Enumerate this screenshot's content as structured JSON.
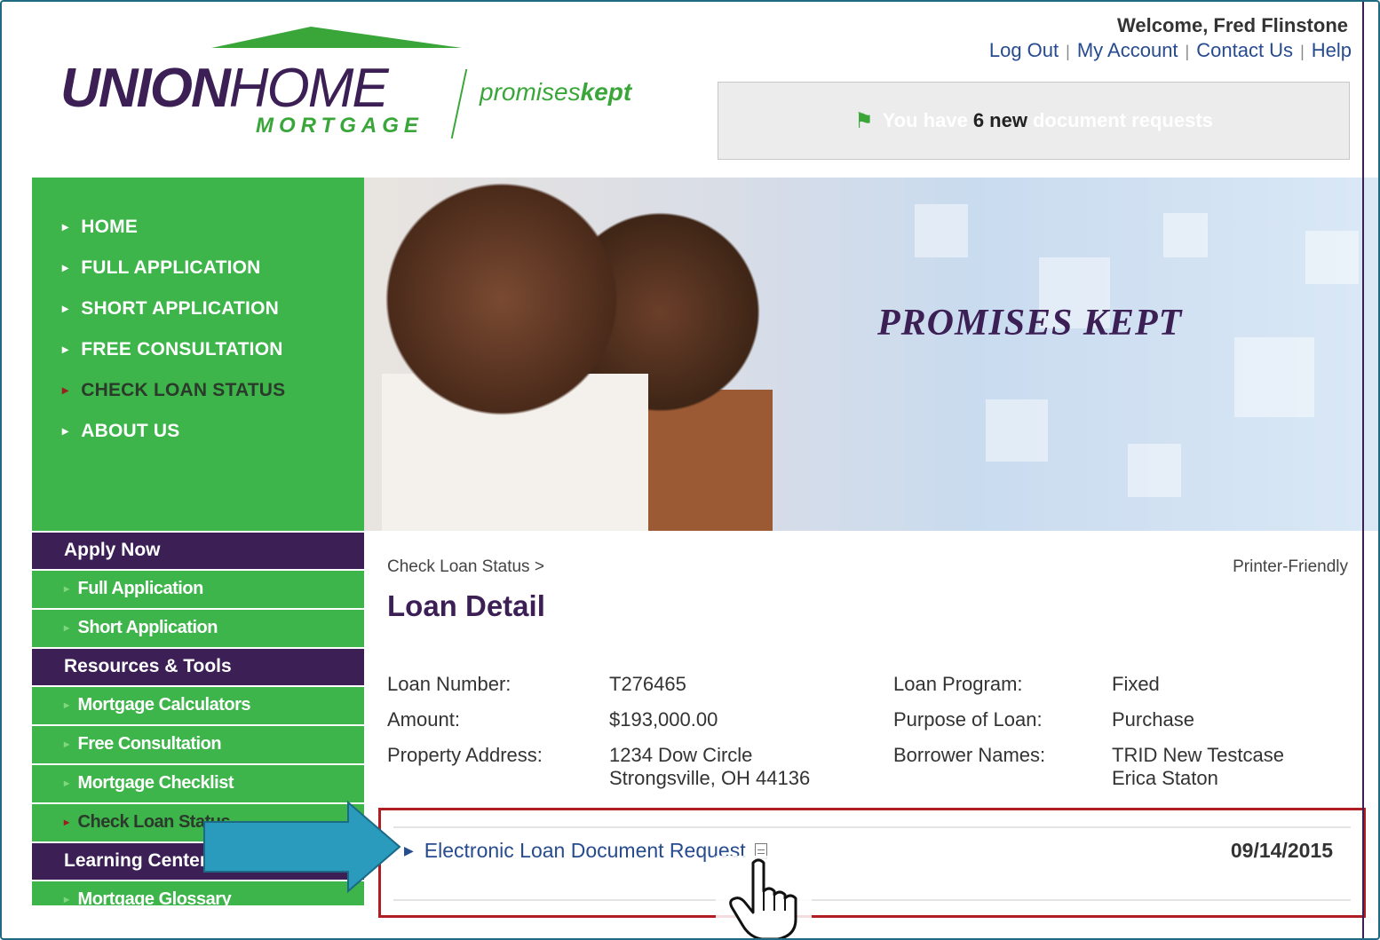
{
  "header": {
    "logo": {
      "word_bold": "UNION",
      "word_light": "HOME",
      "sub": "MORTGAGE",
      "tag_light": "promises",
      "tag_bold": "kept"
    },
    "welcome": "Welcome, Fred Flinstone",
    "links": [
      "Log Out",
      "My Account",
      "Contact Us",
      "Help"
    ],
    "notice": {
      "pre": "You have",
      "count": "6 new",
      "post": "document requests"
    }
  },
  "nav": {
    "items": [
      {
        "label": "HOME",
        "active": false
      },
      {
        "label": "FULL APPLICATION",
        "active": false
      },
      {
        "label": "SHORT APPLICATION",
        "active": false
      },
      {
        "label": "FREE CONSULTATION",
        "active": false
      },
      {
        "label": "CHECK LOAN STATUS",
        "active": true
      },
      {
        "label": "ABOUT US",
        "active": false
      }
    ]
  },
  "hero": {
    "slogan": "PROMISES KEPT"
  },
  "sidebar": {
    "sections": [
      {
        "title": "Apply Now",
        "items": [
          "Full Application",
          "Short Application"
        ]
      },
      {
        "title": "Resources & Tools",
        "items": [
          "Mortgage Calculators",
          "Free Consultation",
          "Mortgage Checklist",
          "Check Loan Status"
        ]
      },
      {
        "title": "Learning Center",
        "items": [
          "Mortgage Glossary"
        ]
      }
    ],
    "active_item": "Check Loan Status"
  },
  "main": {
    "breadcrumb": "Check Loan Status >",
    "printer_friendly": "Printer-Friendly",
    "title": "Loan Detail",
    "details": {
      "loan_number_label": "Loan Number:",
      "loan_number": "T276465",
      "amount_label": "Amount:",
      "amount": "$193,000.00",
      "address_label": "Property Address:",
      "address_line1": "1234 Dow Circle",
      "address_line2": "Strongsville, OH 44136",
      "program_label": "Loan Program:",
      "program": "Fixed",
      "purpose_label": "Purpose of Loan:",
      "purpose": "Purchase",
      "borrowers_label": "Borrower Names:",
      "borrower1": "TRID New Testcase",
      "borrower2": "Erica Staton"
    },
    "document": {
      "link": "Electronic Loan Document Request",
      "date": "09/14/2015"
    }
  },
  "colors": {
    "purple": "#3b1f55",
    "green": "#3db54a",
    "link": "#274b8f",
    "highlight": "#b01e24",
    "arrow": "#2a9bbd"
  }
}
